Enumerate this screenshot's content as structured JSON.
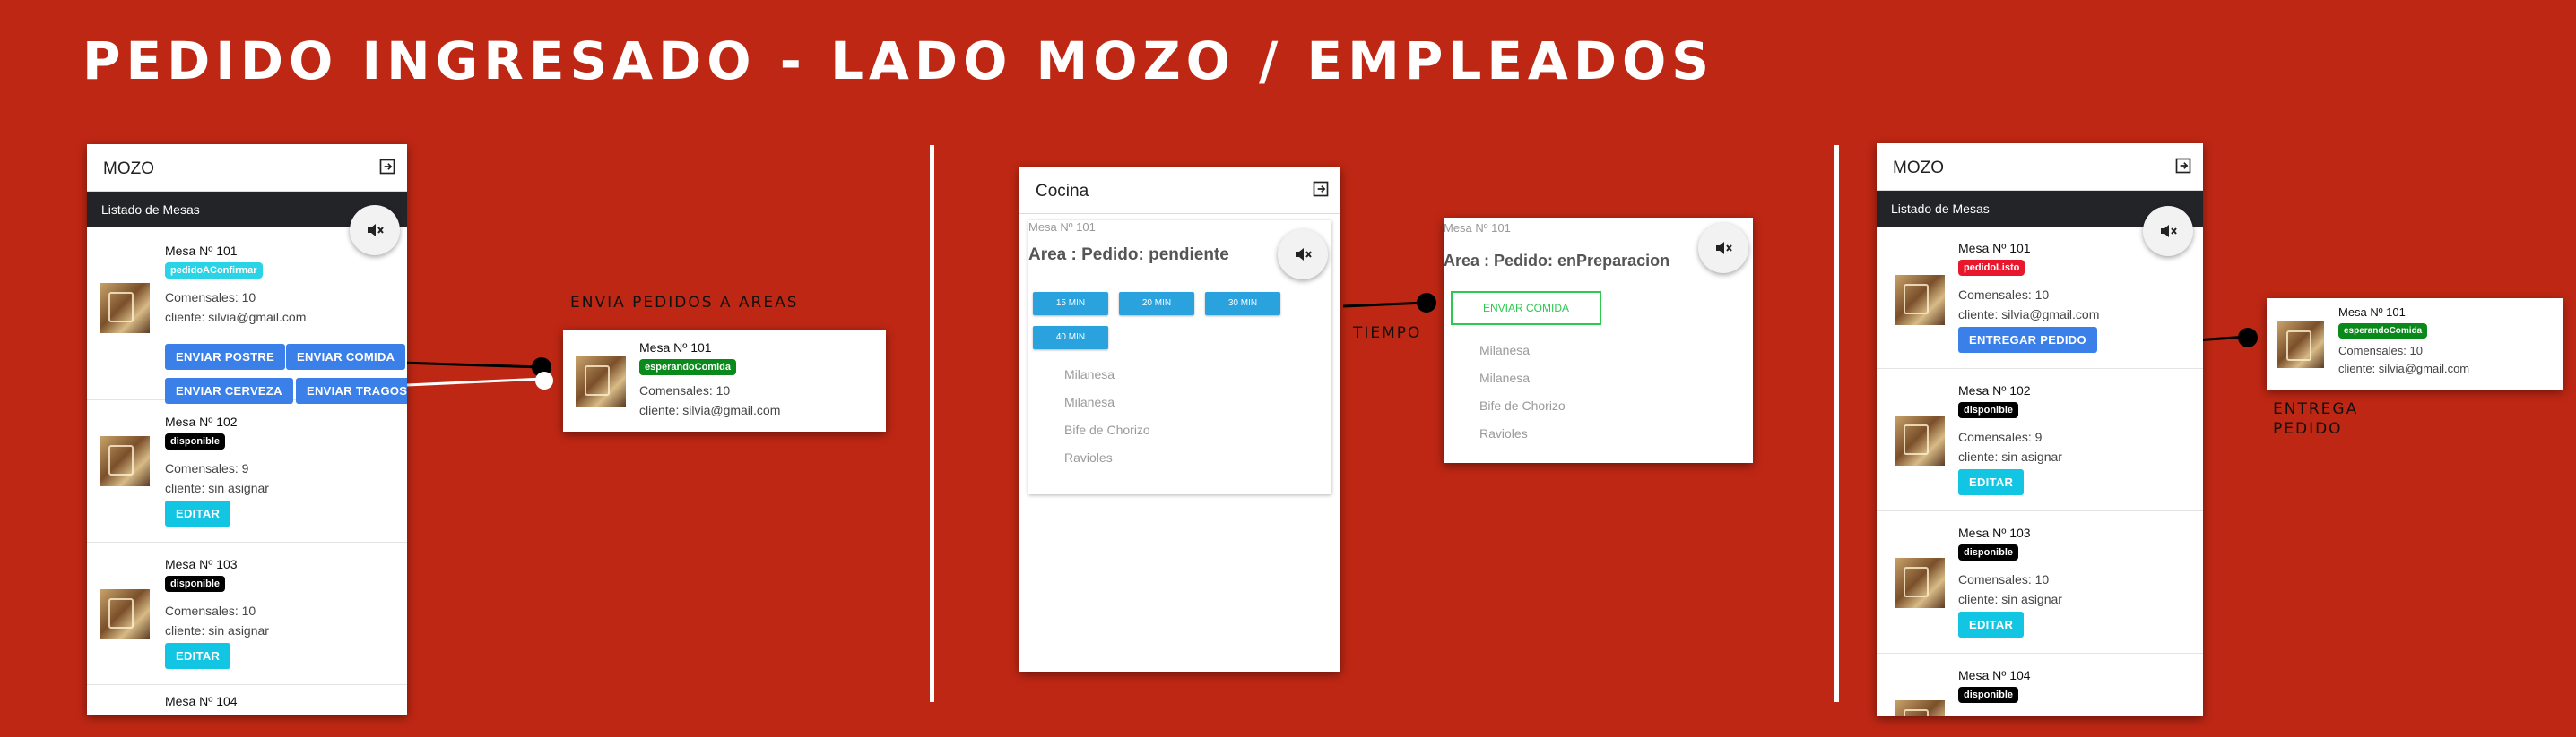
{
  "title": "PEDIDO INGRESADO - LADO MOZO / EMPLEADOS",
  "labels": {
    "envia": "ENVIA PEDIDOS A AREAS",
    "tiempo": "TIEMPO",
    "entrega_1": "ENTREGA",
    "entrega_2": "PEDIDO"
  },
  "colors": {
    "background": "#be2714",
    "accent_blue": "#3b7fe8",
    "accent_cyan": "#12c5e3",
    "status_cyan": "#2ad4e6",
    "status_green": "#0a8a1a",
    "status_red": "#e8172d"
  },
  "icons": {
    "logout": "logout-icon",
    "mute": "volume-off-icon",
    "thumbnail": "restaurant-photo"
  },
  "mozo1": {
    "header": "MOZO",
    "subheader": "Listado de Mesas",
    "tables": [
      {
        "mesa": "Mesa Nº 101",
        "estado": "pedidoAConfirmar",
        "comensales": "Comensales: 10",
        "cliente": "cliente: silvia@gmail.com",
        "buttons": [
          "ENVIAR POSTRE",
          "ENVIAR COMIDA",
          "ENVIAR CERVEZA",
          "ENVIAR TRAGOS"
        ]
      },
      {
        "mesa": "Mesa Nº 102",
        "estado": "disponible",
        "comensales": "Comensales: 9",
        "cliente": "cliente: sin asignar",
        "button": "EDITAR"
      },
      {
        "mesa": "Mesa Nº 103",
        "estado": "disponible",
        "comensales": "Comensales: 10",
        "cliente": "cliente: sin asignar",
        "button": "EDITAR"
      },
      {
        "mesa": "Mesa Nº 104"
      }
    ]
  },
  "card_envia": {
    "mesa": "Mesa Nº 101",
    "estado": "esperandoComida",
    "comensales": "Comensales: 10",
    "cliente": "cliente: silvia@gmail.com"
  },
  "cocina": {
    "header": "Cocina",
    "mesa": "Mesa Nº 101",
    "area": "Area : Pedido:",
    "estado": "pendiente",
    "tiempos": [
      "15 MIN",
      "20 MIN",
      "30 MIN",
      "40 MIN"
    ],
    "items": [
      "Milanesa",
      "Milanesa",
      "Bife de Chorizo",
      "Ravioles"
    ]
  },
  "cocina_card": {
    "mesa": "Mesa Nº 101",
    "area": "Area : Pedido:",
    "estado": "enPreparacion",
    "button": "ENVIAR COMIDA",
    "items": [
      "Milanesa",
      "Milanesa",
      "Bife de Chorizo",
      "Ravioles"
    ]
  },
  "mozo2": {
    "header": "MOZO",
    "subheader": "Listado de Mesas",
    "tables": [
      {
        "mesa": "Mesa Nº 101",
        "estado": "pedidoListo",
        "comensales": "Comensales: 10",
        "cliente": "cliente: silvia@gmail.com",
        "button": "ENTREGAR PEDIDO"
      },
      {
        "mesa": "Mesa Nº 102",
        "estado": "disponible",
        "comensales": "Comensales: 9",
        "cliente": "cliente: sin asignar",
        "button": "EDITAR"
      },
      {
        "mesa": "Mesa Nº 103",
        "estado": "disponible",
        "comensales": "Comensales: 10",
        "cliente": "cliente: sin asignar",
        "button": "EDITAR"
      },
      {
        "mesa": "Mesa Nº 104",
        "estado": "disponible"
      }
    ]
  },
  "card_entrega": {
    "mesa": "Mesa Nº 101",
    "estado": "esperandoComida",
    "comensales": "Comensales: 10",
    "cliente": "cliente: silvia@gmail.com"
  }
}
